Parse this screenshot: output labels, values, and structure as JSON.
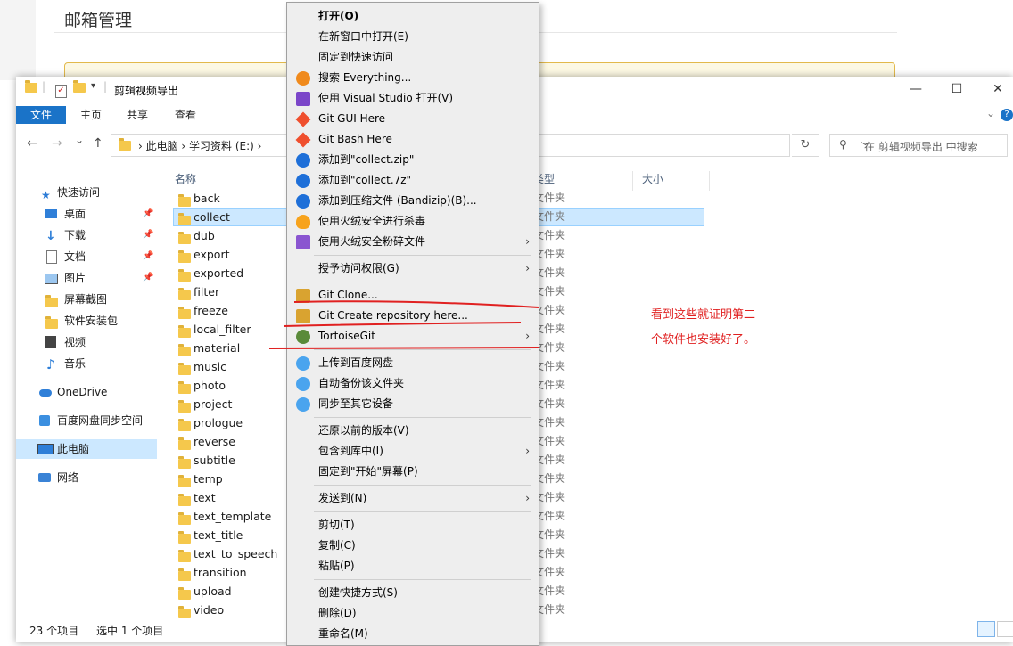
{
  "background_page": {
    "title": "邮箱管理"
  },
  "window": {
    "title": "剪辑视频导出",
    "controls": {
      "minimize": "—",
      "maximize": "☐",
      "close": "✕"
    }
  },
  "ribbon": {
    "tabs": [
      "文件",
      "主页",
      "共享",
      "查看"
    ]
  },
  "navigation": {
    "back": "←",
    "forward": "→",
    "history": "⌄",
    "up": "↑",
    "address": "›  此电脑  ›  学习资料 (E:)  ›",
    "refresh": "↻",
    "search_placeholder": "在 剪辑视频导出 中搜索"
  },
  "sidebar": {
    "items": [
      {
        "label": "快速访问",
        "icon": "star-icon"
      },
      {
        "label": "桌面",
        "icon": "desktop-icon",
        "pinned": true
      },
      {
        "label": "下载",
        "icon": "download-icon",
        "pinned": true
      },
      {
        "label": "文档",
        "icon": "document-icon",
        "pinned": true
      },
      {
        "label": "图片",
        "icon": "picture-icon",
        "pinned": true
      },
      {
        "label": "屏幕截图",
        "icon": "folder-icon"
      },
      {
        "label": "软件安装包",
        "icon": "folder-icon"
      },
      {
        "label": "视频",
        "icon": "video-icon"
      },
      {
        "label": "音乐",
        "icon": "music-icon"
      },
      {
        "label": "OneDrive",
        "icon": "cloud-icon"
      },
      {
        "label": "百度网盘同步空间",
        "icon": "baidu-sync-icon"
      },
      {
        "label": "此电脑",
        "icon": "computer-icon",
        "selected": true
      },
      {
        "label": "网络",
        "icon": "network-icon"
      }
    ]
  },
  "file_list": {
    "columns": {
      "name": "名称",
      "type": "类型",
      "size": "大小"
    },
    "rows": [
      {
        "name": "back",
        "type": "文件夹"
      },
      {
        "name": "collect",
        "type": "文件夹",
        "selected": true
      },
      {
        "name": "dub",
        "type": "文件夹"
      },
      {
        "name": "export",
        "type": "文件夹"
      },
      {
        "name": "exported",
        "type": "文件夹"
      },
      {
        "name": "filter",
        "type": "文件夹"
      },
      {
        "name": "freeze",
        "type": "文件夹"
      },
      {
        "name": "local_filter",
        "type": "文件夹"
      },
      {
        "name": "material",
        "type": "文件夹"
      },
      {
        "name": "music",
        "type": "文件夹"
      },
      {
        "name": "photo",
        "type": "文件夹"
      },
      {
        "name": "project",
        "type": "文件夹"
      },
      {
        "name": "prologue",
        "type": "文件夹"
      },
      {
        "name": "reverse",
        "type": "文件夹"
      },
      {
        "name": "subtitle",
        "type": "文件夹"
      },
      {
        "name": "temp",
        "type": "文件夹"
      },
      {
        "name": "text",
        "type": "文件夹"
      },
      {
        "name": "text_template",
        "type": "文件夹"
      },
      {
        "name": "text_title",
        "type": "文件夹"
      },
      {
        "name": "text_to_speech",
        "type": "文件夹"
      },
      {
        "name": "transition",
        "type": "文件夹"
      },
      {
        "name": "upload",
        "type": "文件夹"
      },
      {
        "name": "video",
        "type": "文件夹"
      }
    ]
  },
  "status_bar": {
    "item_count": "23 个项目",
    "selection": "选中 1 个项目"
  },
  "context_menu": {
    "items": [
      {
        "label": "打开(O)",
        "bold": true
      },
      {
        "label": "在新窗口中打开(E)"
      },
      {
        "label": "固定到快速访问"
      },
      {
        "label": "搜索 Everything...",
        "icon": "everything-search-icon"
      },
      {
        "label": "使用 Visual Studio 打开(V)",
        "icon": "visual-studio-icon"
      },
      {
        "label": "Git GUI Here",
        "icon": "git-icon"
      },
      {
        "label": "Git Bash Here",
        "icon": "git-icon"
      },
      {
        "label": "添加到\"collect.zip\"",
        "icon": "bandizip-icon"
      },
      {
        "label": "添加到\"collect.7z\"",
        "icon": "bandizip-icon"
      },
      {
        "label": "添加到压缩文件 (Bandizip)(B)...",
        "icon": "bandizip-icon"
      },
      {
        "label": "使用火绒安全进行杀毒",
        "icon": "huorong-icon"
      },
      {
        "label": "使用火绒安全粉碎文件",
        "icon": "shredder-icon",
        "submenu": true
      },
      {
        "separator": true
      },
      {
        "label": "授予访问权限(G)",
        "submenu": true
      },
      {
        "separator": true
      },
      {
        "label": "Git Clone...",
        "icon": "git-clone-icon"
      },
      {
        "label": "Git Create repository here...",
        "icon": "git-create-icon"
      },
      {
        "label": "TortoiseGit",
        "icon": "tortoisegit-icon",
        "submenu": true
      },
      {
        "separator": true
      },
      {
        "label": "上传到百度网盘",
        "icon": "baidu-cloud-icon"
      },
      {
        "label": "自动备份该文件夹",
        "icon": "baidu-cloud-icon"
      },
      {
        "label": "同步至其它设备",
        "icon": "baidu-cloud-icon"
      },
      {
        "separator": true
      },
      {
        "label": "还原以前的版本(V)"
      },
      {
        "label": "包含到库中(I)",
        "submenu": true
      },
      {
        "label": "固定到\"开始\"屏幕(P)"
      },
      {
        "separator": true
      },
      {
        "label": "发送到(N)",
        "submenu": true
      },
      {
        "separator": true
      },
      {
        "label": "剪切(T)"
      },
      {
        "label": "复制(C)"
      },
      {
        "label": "粘贴(P)"
      },
      {
        "separator": true
      },
      {
        "label": "创建快捷方式(S)"
      },
      {
        "label": "删除(D)"
      },
      {
        "label": "重命名(M)"
      }
    ]
  },
  "annotation": {
    "text_line1": "看到这些就证明第二",
    "text_line2": "个软件也安装好了。",
    "color": "#e02020"
  },
  "colors": {
    "accent": "#1a73c8",
    "selection": "#cce8ff",
    "folder": "#f5c84c"
  }
}
